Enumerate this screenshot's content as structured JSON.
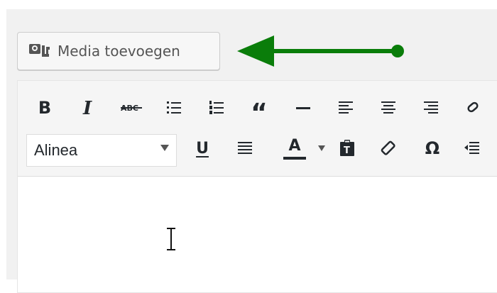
{
  "media_button": {
    "label": "Media toevoegen",
    "icon": "add-media-icon"
  },
  "arrow": {
    "color": "#0a7d0a"
  },
  "toolbar": {
    "row1": [
      {
        "name": "bold-button",
        "glyph": "B"
      },
      {
        "name": "italic-button",
        "glyph": "I"
      },
      {
        "name": "strikethrough-button",
        "glyph": "ABC"
      },
      {
        "name": "bullet-list-button",
        "icon": "bullet-list-icon"
      },
      {
        "name": "numbered-list-button",
        "icon": "numbered-list-icon"
      },
      {
        "name": "blockquote-button",
        "glyph": "“"
      },
      {
        "name": "horizontal-line-button",
        "icon": "horizontal-line-icon"
      },
      {
        "name": "align-left-button",
        "icon": "align-left-icon"
      },
      {
        "name": "align-center-button",
        "icon": "align-center-icon"
      },
      {
        "name": "align-right-button",
        "icon": "align-right-icon"
      },
      {
        "name": "link-button",
        "icon": "link-icon"
      }
    ],
    "row2": {
      "format_select": {
        "value": "Alinea"
      },
      "underline_glyph": "U",
      "text_color_glyph": "A",
      "special_char_glyph": "Ω"
    }
  }
}
